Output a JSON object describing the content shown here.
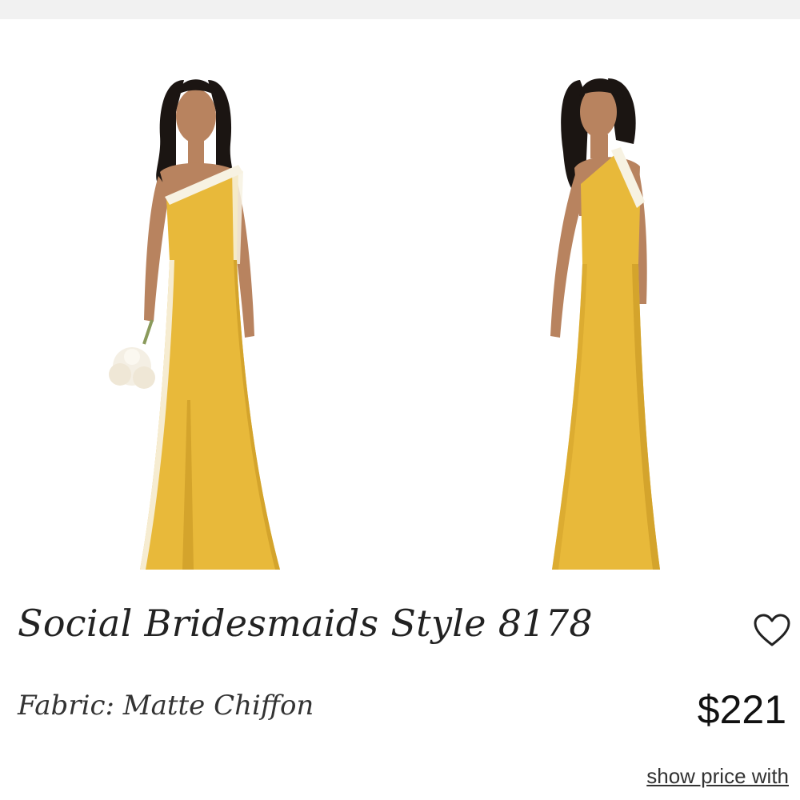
{
  "product": {
    "title": "Social Bridesmaids Style 8178",
    "fabric_label": "Fabric: Matte Chiffon",
    "price": "$221",
    "show_price_link": "show price with"
  },
  "images": [
    {
      "view": "front"
    },
    {
      "view": "back"
    }
  ],
  "icons": {
    "favorite": "heart-icon"
  },
  "colors": {
    "dress": "#e8b93a",
    "dress_shade": "#d4a42c",
    "trim": "#f7f2e2",
    "skin": "#b8835f",
    "hair": "#1b1512",
    "bouquet": "#f4efe4",
    "text": "#222222",
    "top_bar": "#f1f1f1"
  }
}
